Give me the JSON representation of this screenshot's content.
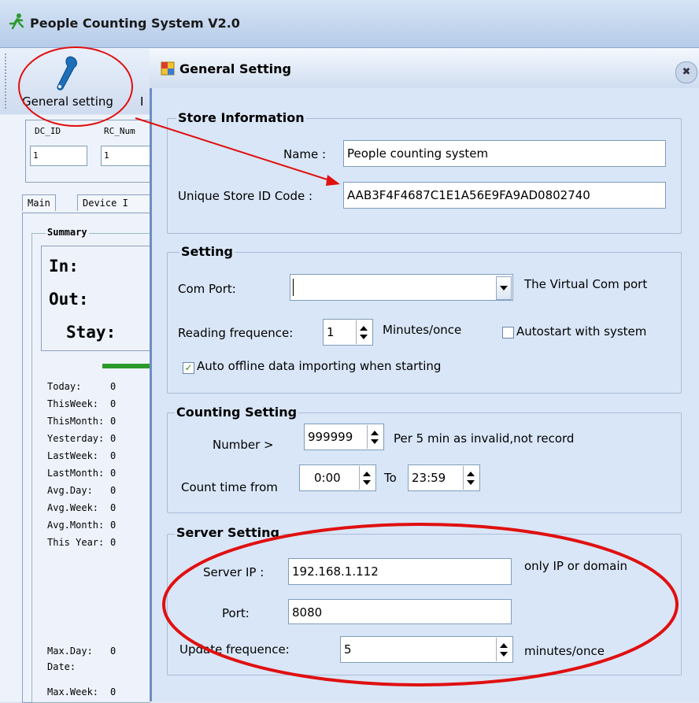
{
  "app": {
    "title": "People Counting System  V2.0"
  },
  "toolbar": {
    "general_label": "General setting",
    "next_label_partial": "I"
  },
  "left": {
    "dc_id_label": "DC_ID",
    "rc_num_label": "RC_Num",
    "dc_id_value": "1",
    "rc_num_value": "1",
    "tabs": [
      "Main",
      "Device I"
    ],
    "summary_label": "Summary",
    "in_label": "In:",
    "out_label": "Out:",
    "stay_label": "Stay:",
    "stats": [
      {
        "label": "Today:",
        "value": "0"
      },
      {
        "label": "ThisWeek:",
        "value": "0"
      },
      {
        "label": "ThisMonth:",
        "value": "0"
      },
      {
        "label": "Yesterday:",
        "value": "0"
      },
      {
        "label": "LastWeek:",
        "value": "0"
      },
      {
        "label": "LastMonth:",
        "value": "0"
      },
      {
        "label": "Avg.Day:",
        "value": "0"
      },
      {
        "label": "Avg.Week:",
        "value": "0"
      },
      {
        "label": "Avg.Month:",
        "value": "0"
      },
      {
        "label": "This Year:",
        "value": "0"
      }
    ],
    "max_day_label": "Max.Day:",
    "max_day_value": "0",
    "date_label": "Date:",
    "max_week_label": "Max.Week:",
    "max_week_value": "0"
  },
  "dialog": {
    "title": "General Setting",
    "close_symbol": "✖",
    "store": {
      "legend": "Store Information",
      "name_label": "Name :",
      "name_value": "People counting system",
      "id_label": "Unique Store ID Code :",
      "id_value": "AAB3F4F4687C1E1A56E9FA9AD0802740"
    },
    "setting": {
      "legend": "Setting",
      "com_label": "Com Port:",
      "com_value": "",
      "com_hint": "The Virtual Com port",
      "freq_label": "Reading frequence:",
      "freq_value": "1",
      "freq_unit": "Minutes/once",
      "autostart_label": "Autostart with system",
      "autostart_checked": false,
      "offline_label": "Auto offline data importing when starting",
      "offline_checked": true
    },
    "counting": {
      "legend": "Counting Setting",
      "number_label": "Number >",
      "number_value": "999999",
      "number_hint": "Per 5 min as invalid,not record",
      "time_label": "Count time from",
      "time_from": "0:00",
      "to_label": "To",
      "time_to": "23:59"
    },
    "server": {
      "legend": "Server Setting",
      "ip_label": "Server IP :",
      "ip_value": "192.168.1.112",
      "ip_hint": "only IP or domain",
      "port_label": "Port:",
      "port_value": "8080",
      "update_label": "Update frequence:",
      "update_value": "5",
      "update_unit": "minutes/once"
    }
  },
  "colors": {
    "annotation": "#e01010",
    "accent": "#1c6fb8"
  }
}
